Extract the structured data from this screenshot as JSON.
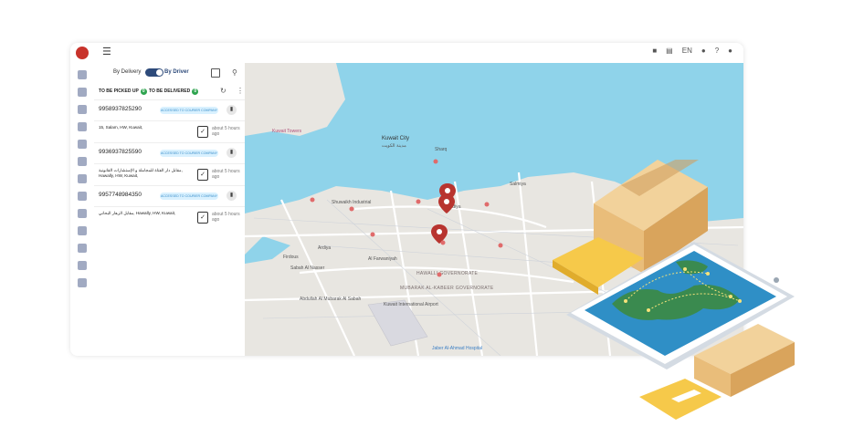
{
  "topbar": {
    "menu_icon": "hamburger-icon",
    "language": "EN",
    "icons": [
      "message-icon",
      "inbox-icon",
      "headset-icon",
      "help-icon",
      "user-icon"
    ]
  },
  "sidebar_icons": [
    "dashboard-icon",
    "truck-icon",
    "box-icon",
    "bank-icon",
    "dollar-icon",
    "chart-icon",
    "hand-icon",
    "box-2-icon",
    "building-icon",
    "grid-icon",
    "contacts-icon",
    "user-settings-icon",
    "settings-icon"
  ],
  "panel": {
    "toggle": {
      "left_label": "By Delivery",
      "right_label": "By Driver",
      "active": "By Driver"
    },
    "tabs": [
      {
        "label": "TO BE PICKED UP",
        "count": "0"
      },
      {
        "label": "TO BE DELIVERED",
        "count": "0"
      }
    ],
    "orders": [
      {
        "phone": "9958937825290",
        "assign_label": "ACCESSED TO COURIER COMPANY",
        "address": "15, Salam, HW, Kuwait,",
        "time": "about 5 hours ago"
      },
      {
        "phone": "9936937825590",
        "assign_label": "ACCESSED TO COURIER COMPANY",
        "address": "مقابل دار الفتاة للمجاملة و الإستشارات القانونية, Hawally, HW, Kuwait,",
        "time": "about 5 hours ago"
      },
      {
        "phone": "9957748984350",
        "assign_label": "ACCESSED TO COURIER COMPANY",
        "address": "مقابل الزهار البحاني, Hawally, HW, Kuwait,",
        "time": "about 5 hours ago"
      }
    ]
  },
  "map": {
    "labels": [
      {
        "text": "Kuwait City",
        "cls": "big"
      },
      {
        "text": "مدينة الكويت",
        "cls": ""
      },
      {
        "text": "Kuwait Towers",
        "cls": "pink"
      },
      {
        "text": "Shuwaikh Industrial",
        "cls": ""
      },
      {
        "text": "Sharq",
        "cls": ""
      },
      {
        "text": "Salmiya",
        "cls": ""
      },
      {
        "text": "Ardiya",
        "cls": ""
      },
      {
        "text": "Firdous",
        "cls": ""
      },
      {
        "text": "Sabah Al Nasser",
        "cls": ""
      },
      {
        "text": "Al Farwaniyah",
        "cls": ""
      },
      {
        "text": "HAWALLI GOVERNORATE",
        "cls": "gov"
      },
      {
        "text": "MUBARAK AL-KABEER GOVERNORATE",
        "cls": "gov"
      },
      {
        "text": "Abdullah Al Mubarak Al Sabah",
        "cls": ""
      },
      {
        "text": "Kuwait International Airport",
        "cls": ""
      },
      {
        "text": "Jaber Al-Ahmad Hospital",
        "cls": "blue"
      },
      {
        "text": "Hadiya",
        "cls": ""
      }
    ],
    "colors": {
      "water": "#8fd3ea",
      "land": "#e8e6e1",
      "road": "#ffffff",
      "marker": "#b8342f"
    }
  }
}
